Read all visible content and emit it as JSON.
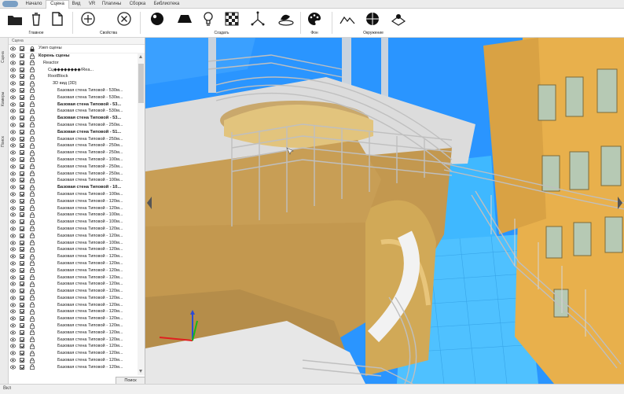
{
  "menu": {
    "tabs": [
      {
        "label": "Начало",
        "active": false
      },
      {
        "label": "Сцена",
        "active": true
      },
      {
        "label": "Вид",
        "active": false
      },
      {
        "label": "VR",
        "active": false
      },
      {
        "label": "Плагины",
        "active": false
      },
      {
        "label": "Сборка",
        "active": false
      },
      {
        "label": "Библиотека",
        "active": false
      }
    ]
  },
  "ribbon": {
    "main_label": "Главное",
    "properties_label": "Свойства",
    "create_label": "Создать",
    "background_label": "Фон",
    "environment_label": "Окружение",
    "icons": [
      "folder-icon",
      "trash-icon",
      "new-document-icon",
      "add-circle-icon",
      "remove-circle-icon",
      "sphere-icon",
      "plane-icon",
      "lightbulb-icon",
      "checker-texture-icon",
      "axes-gizmo-icon",
      "terrain-object-icon",
      "palette-icon",
      "landscape-icon",
      "hdri-sphere-icon",
      "ground-plane-icon"
    ]
  },
  "left_tabs": [
    "Сцена",
    "Камеры",
    "Поиск"
  ],
  "panel": {
    "title": "Сцена",
    "search_button": "Поиск",
    "header_label": "Узел сцены",
    "rows": [
      {
        "label": "Корень сцены",
        "indent": 0,
        "bold": true
      },
      {
        "label": "Reactor",
        "indent": 1
      },
      {
        "label": "Сц◆◆◆◆◆◆◆◆/Rea...",
        "indent": 2
      },
      {
        "label": "RootBlock",
        "indent": 2
      },
      {
        "label": "3D вид (3D)",
        "indent": 3
      },
      {
        "label": "Базовая стена Типовой - 530м...",
        "indent": 4
      },
      {
        "label": "Базовая стена Типовой - 530м...",
        "indent": 4
      },
      {
        "label": "Базовая стена Типовой - 53...",
        "indent": 4,
        "bold": true
      },
      {
        "label": "Базовая стена Типовой - 530м...",
        "indent": 4
      },
      {
        "label": "Базовая стена Типовой - 53...",
        "indent": 4,
        "bold": true
      },
      {
        "label": "Базовая стена Типовой - 250м...",
        "indent": 4
      },
      {
        "label": "Базовая стена Типовой - 51...",
        "indent": 4,
        "bold": true
      },
      {
        "label": "Базовая стена Типовой - 250м...",
        "indent": 4
      },
      {
        "label": "Базовая стена Типовой - 250м...",
        "indent": 4
      },
      {
        "label": "Базовая стена Типовой - 250м...",
        "indent": 4
      },
      {
        "label": "Базовая стена Типовой - 100м...",
        "indent": 4
      },
      {
        "label": "Базовая стена Типовой - 250м...",
        "indent": 4
      },
      {
        "label": "Базовая стена Типовой - 250м...",
        "indent": 4
      },
      {
        "label": "Базовая стена Типовой - 100м...",
        "indent": 4
      },
      {
        "label": "Базовая стена Типовой - 10...",
        "indent": 4,
        "bold": true
      },
      {
        "label": "Базовая стена Типовой - 100м...",
        "indent": 4
      },
      {
        "label": "Базовая стена Типовой - 120м...",
        "indent": 4
      },
      {
        "label": "Базовая стена Типовой - 120м...",
        "indent": 4
      },
      {
        "label": "Базовая стена Типовой - 100м...",
        "indent": 4
      },
      {
        "label": "Базовая стена Типовой - 100м...",
        "indent": 4
      },
      {
        "label": "Базовая стена Типовой - 120м...",
        "indent": 4
      },
      {
        "label": "Базовая стена Типовой - 120м...",
        "indent": 4
      },
      {
        "label": "Базовая стена Типовой - 100м...",
        "indent": 4
      },
      {
        "label": "Базовая стена Типовой - 120м...",
        "indent": 4
      },
      {
        "label": "Базовая стена Типовой - 120м...",
        "indent": 4
      },
      {
        "label": "Базовая стена Типовой - 120м...",
        "indent": 4
      },
      {
        "label": "Базовая стена Типовой - 120м...",
        "indent": 4
      },
      {
        "label": "Базовая стена Типовой - 120м...",
        "indent": 4
      },
      {
        "label": "Базовая стена Типовой - 120м...",
        "indent": 4
      },
      {
        "label": "Базовая стена Типовой - 120м...",
        "indent": 4
      },
      {
        "label": "Базовая стена Типовой - 120м...",
        "indent": 4
      },
      {
        "label": "Базовая стена Типовой - 120м...",
        "indent": 4
      },
      {
        "label": "Базовая стена Типовой - 120м...",
        "indent": 4
      },
      {
        "label": "Базовая стена Типовой - 120м...",
        "indent": 4
      },
      {
        "label": "Базовая стена Типовой - 120м...",
        "indent": 4
      },
      {
        "label": "Базовая стена Типовой - 120м...",
        "indent": 4
      },
      {
        "label": "Базовая стена Типовой - 120м...",
        "indent": 4
      },
      {
        "label": "Базовая стена Типовой - 120м...",
        "indent": 4
      },
      {
        "label": "Базовая стена Типовой - 120м...",
        "indent": 4
      },
      {
        "label": "Базовая стена Типовой - 120м...",
        "indent": 4
      },
      {
        "label": "Базовая стена Типовой - 120м...",
        "indent": 4
      }
    ]
  },
  "status": {
    "text": "Вкл"
  },
  "colors": {
    "sky": "#1f8fff",
    "floor": "#b8955a",
    "railing": "#c8c8c8",
    "water": "#3fb8ff",
    "building": "#e8b04c"
  }
}
